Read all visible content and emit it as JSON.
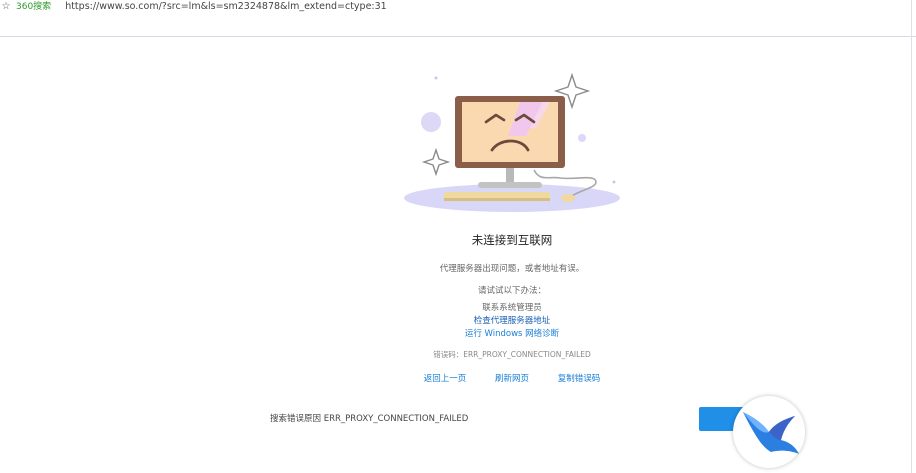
{
  "topbar": {
    "brand": "360搜索",
    "url": "https://www.so.com/?src=lm&ls=sm2324878&lm_extend=ctype:31"
  },
  "page": {
    "title": "未连接到互联网",
    "subtitle": "代理服务器出现问题，或者地址有误。",
    "suggest_heading": "请试试以下办法：",
    "suggestions": [
      "联系系统管理员",
      "检查代理服务器地址",
      "运行 Windows 网络诊断"
    ],
    "error_label": "错误码：",
    "error_code": "ERR_PROXY_CONNECTION_FAILED",
    "actions": {
      "back": "返回上一页",
      "refresh": "刷新网页",
      "copy": "复制错误码"
    },
    "search_reason": "搜索错误原因 ERR_PROXY_CONNECTION_FAILED"
  },
  "colors": {
    "accent_blue": "#1f8fe8",
    "link_blue": "#1a7fd6",
    "brand_green": "#2e9a2e",
    "monitor_frame": "#8b5e4a",
    "screen": "#fbd9b0",
    "shadow": "#d9d7f7"
  },
  "icons": {
    "star": "star-icon",
    "monitor": "sad-monitor-illustration",
    "bird": "bird-logo-icon"
  }
}
